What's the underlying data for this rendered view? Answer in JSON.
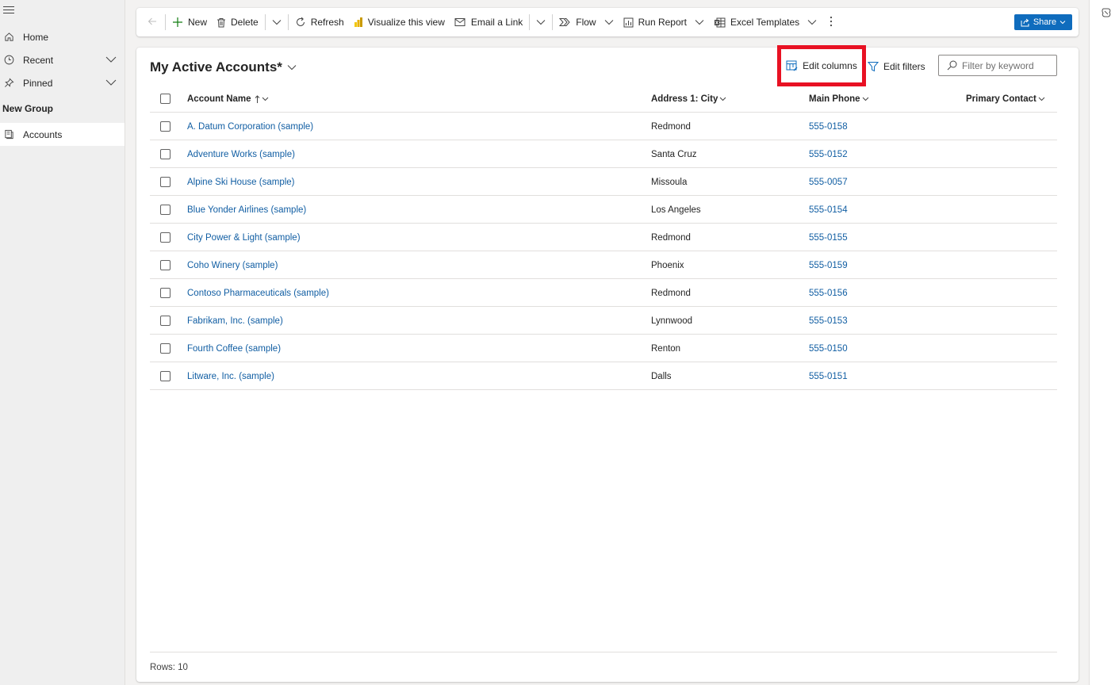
{
  "nav": {
    "items": [
      {
        "label": "Home",
        "icon": "home-icon"
      },
      {
        "label": "Recent",
        "icon": "clock-icon"
      },
      {
        "label": "Pinned",
        "icon": "pin-icon"
      }
    ],
    "group_label": "New Group",
    "active_item": {
      "label": "Accounts",
      "icon": "accounts-icon"
    }
  },
  "commandbar": {
    "new_label": "New",
    "delete_label": "Delete",
    "refresh_label": "Refresh",
    "visualize_label": "Visualize this view",
    "email_link_label": "Email a Link",
    "flow_label": "Flow",
    "run_report_label": "Run Report",
    "excel_templates_label": "Excel Templates",
    "share_label": "Share"
  },
  "view": {
    "title": "My Active Accounts*",
    "edit_columns_label": "Edit columns",
    "edit_filters_label": "Edit filters",
    "filter_placeholder": "Filter by keyword"
  },
  "grid": {
    "columns": {
      "name": "Account Name",
      "city": "Address 1: City",
      "phone": "Main Phone",
      "contact": "Primary Contact"
    },
    "rows": [
      {
        "name": "A. Datum Corporation (sample)",
        "city": "Redmond",
        "phone": "555-0158",
        "contact": ""
      },
      {
        "name": "Adventure Works (sample)",
        "city": "Santa Cruz",
        "phone": "555-0152",
        "contact": ""
      },
      {
        "name": "Alpine Ski House (sample)",
        "city": "Missoula",
        "phone": "555-0057",
        "contact": ""
      },
      {
        "name": "Blue Yonder Airlines (sample)",
        "city": "Los Angeles",
        "phone": "555-0154",
        "contact": ""
      },
      {
        "name": "City Power & Light (sample)",
        "city": "Redmond",
        "phone": "555-0155",
        "contact": ""
      },
      {
        "name": "Coho Winery (sample)",
        "city": "Phoenix",
        "phone": "555-0159",
        "contact": ""
      },
      {
        "name": "Contoso Pharmaceuticals (sample)",
        "city": "Redmond",
        "phone": "555-0156",
        "contact": ""
      },
      {
        "name": "Fabrikam, Inc. (sample)",
        "city": "Lynnwood",
        "phone": "555-0153",
        "contact": ""
      },
      {
        "name": "Fourth Coffee (sample)",
        "city": "Renton",
        "phone": "555-0150",
        "contact": ""
      },
      {
        "name": "Litware, Inc. (sample)",
        "city": "Dalls",
        "phone": "555-0151",
        "contact": ""
      }
    ],
    "rows_count": "Rows: 10"
  },
  "colors": {
    "accent": "#0f6cbd",
    "link": "#115ea3",
    "highlight": "#e81123"
  }
}
